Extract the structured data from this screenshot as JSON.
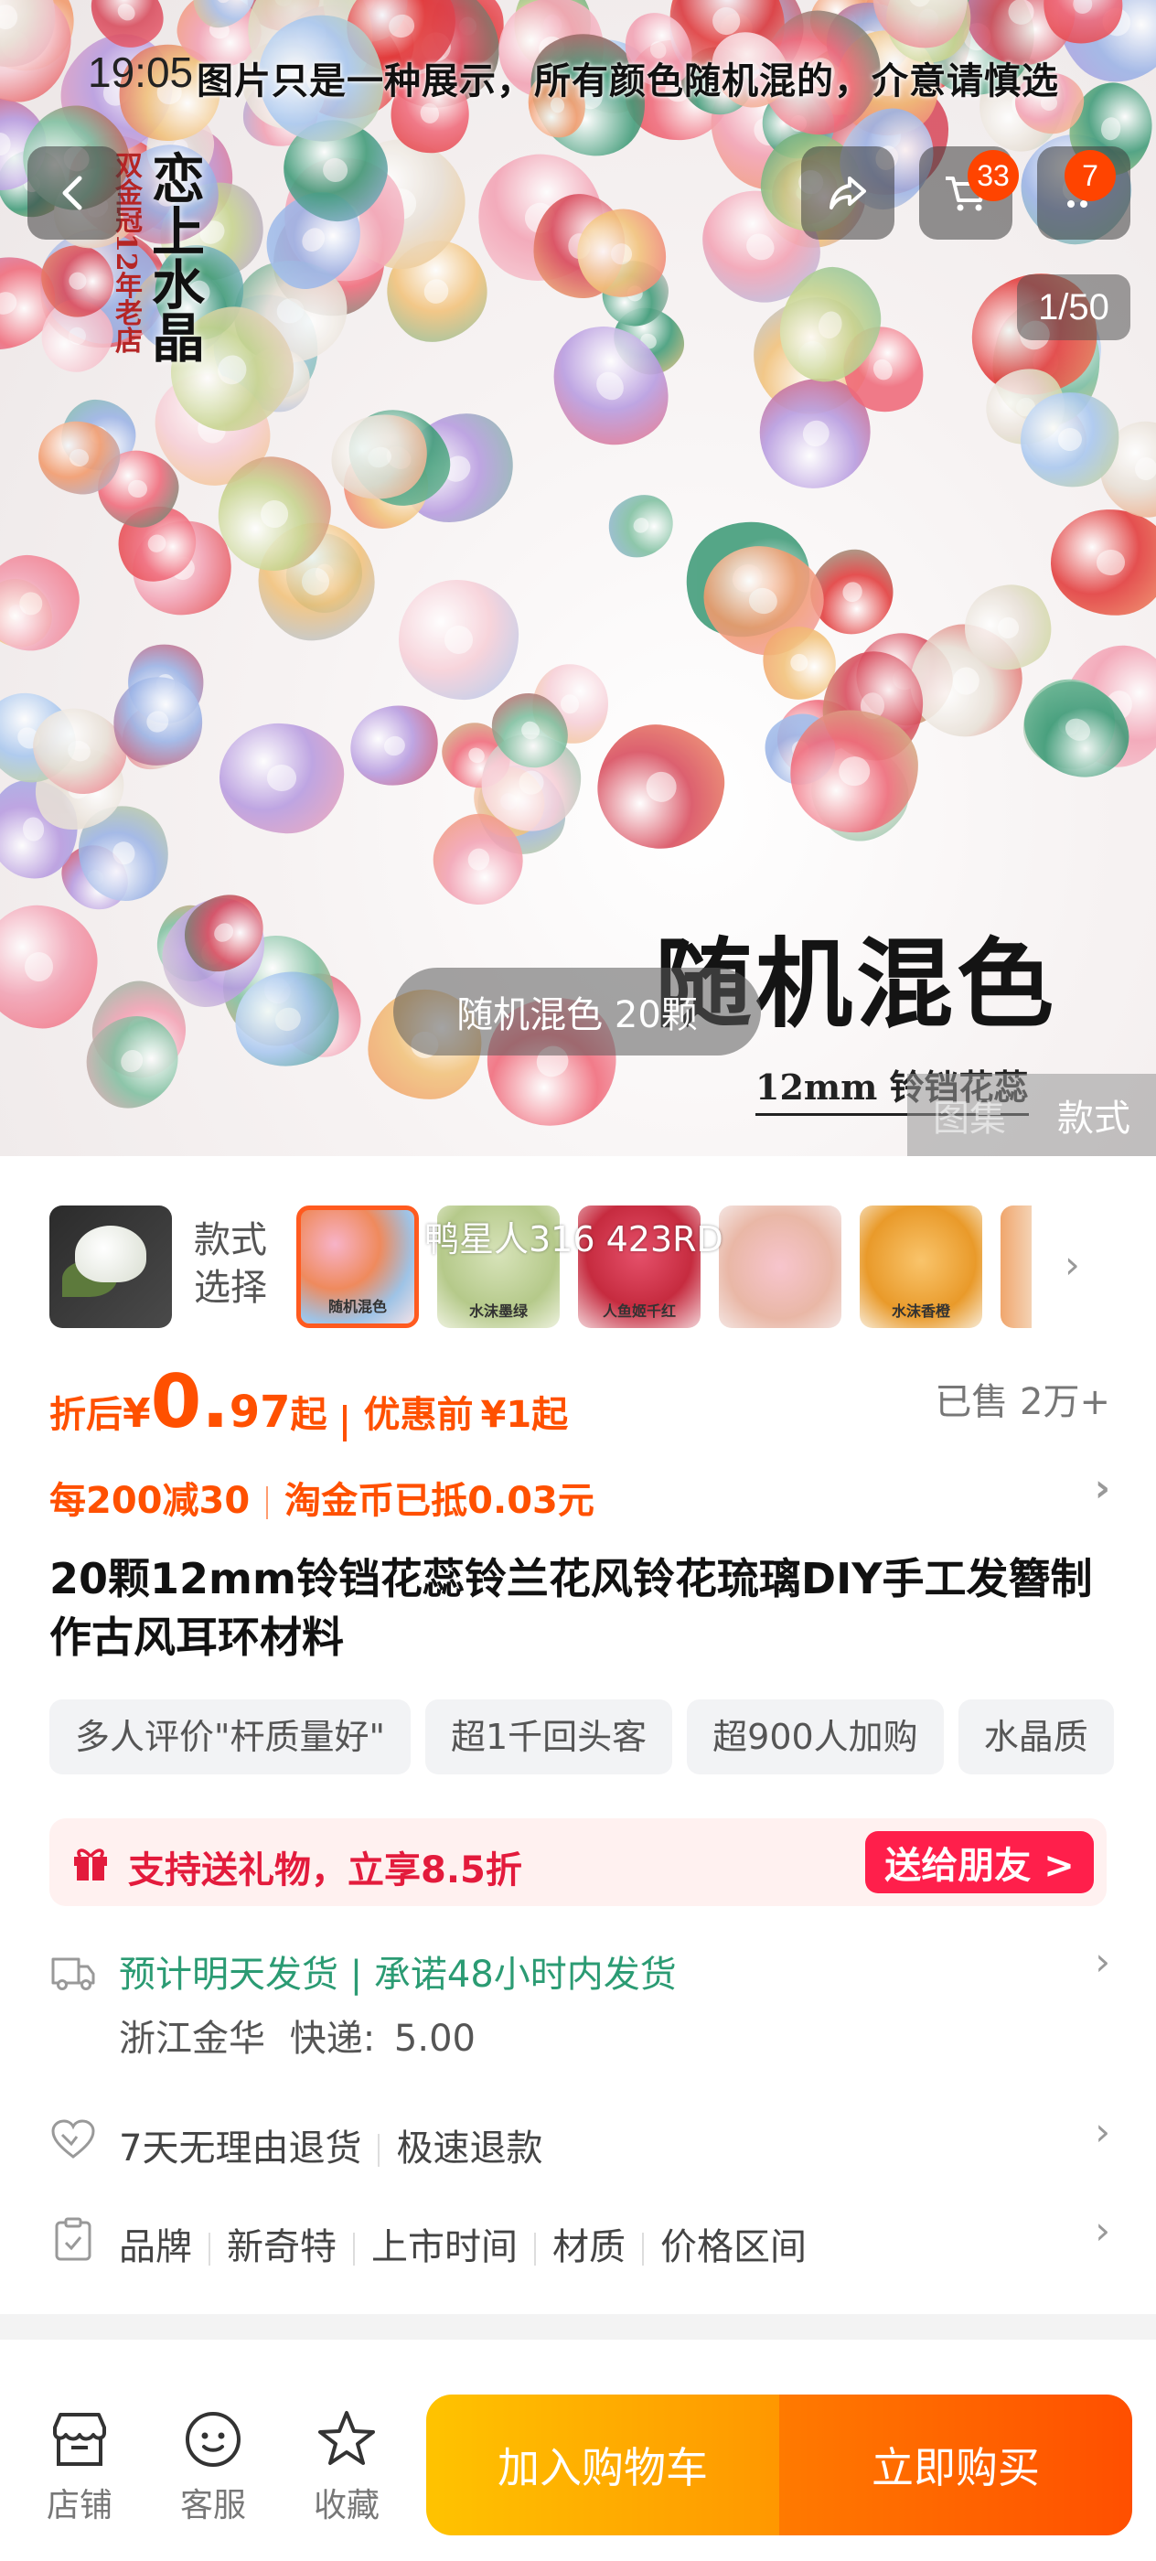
{
  "status": {
    "time": "19:05"
  },
  "hero": {
    "banner_text": "图片只是一种展示，所有颜色随机混的，介意请慎选",
    "shop_name_vertical": "恋上水晶",
    "shop_tagline_vertical": "双金冠12年老店",
    "title": "随机混色",
    "subtitle": "12mm 铃铛花蕊",
    "image_counter": "1/50",
    "variant_pill": "随机混色 20颗",
    "view_toggle": [
      "图集",
      "款式"
    ]
  },
  "nav": {
    "cart_badge": "33",
    "message_badge": "7"
  },
  "styles": {
    "label": "款式选择",
    "thumb_captions": [
      "随机混色",
      "水沫墨绿",
      "人鱼姬千红",
      "",
      "水沫香橙"
    ],
    "overlay_text": "鸭星人316  423RD"
  },
  "price": {
    "label": "折后",
    "currency": "¥",
    "integer": "0.",
    "decimal": "97",
    "suffix": "起",
    "before_label": "优惠前",
    "before_price": "¥1起",
    "sold": "已售 2万+"
  },
  "promo": {
    "deal": "每200减30",
    "coins": "淘金币已抵0.03元"
  },
  "product_title": "20颗12mm铃铛花蕊铃兰花风铃花琉璃DIY手工发簪制作古风耳环材料",
  "tags": [
    "多人评价\"杆质量好\"",
    "超1千回头客",
    "超900人加购",
    "水晶质"
  ],
  "gift": {
    "text": "支持送礼物，立享8.5折",
    "button": "送给朋友 >"
  },
  "shipping": {
    "main": "预计明天发货 | 承诺48小时内发货",
    "origin": "浙江金华",
    "fee_label": "快递:",
    "fee": "5.00"
  },
  "returns": {
    "items": [
      "7天无理由退货",
      "极速退款"
    ]
  },
  "specs": {
    "items": [
      "品牌",
      "新奇特",
      "上市时间",
      "材质",
      "价格区间"
    ]
  },
  "bottom_bar": {
    "store": "店铺",
    "service": "客服",
    "favorite": "收藏",
    "add_cart": "加入购物车",
    "buy_now": "立即购买"
  },
  "colors": {
    "accent": "#ff5000",
    "gift_red": "#e31b3c",
    "ship_green": "#2b9b73"
  }
}
